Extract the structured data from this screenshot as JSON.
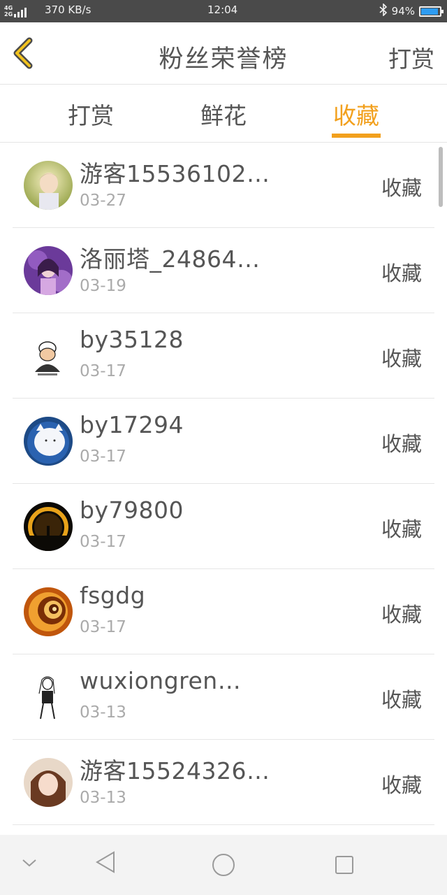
{
  "status_bar": {
    "network": "4G",
    "network2": "2G",
    "speed": "370 KB/s",
    "time": "12:04",
    "battery": "94%",
    "battery_level": 0.94,
    "battery_color": "#2e9cf2"
  },
  "header": {
    "back_icon": "chevron-left-icon",
    "title": "粉丝荣誉榜",
    "action_label": "打赏"
  },
  "tabs": [
    {
      "label": "打赏",
      "active": false
    },
    {
      "label": "鲜花",
      "active": false
    },
    {
      "label": "收藏",
      "active": true
    }
  ],
  "accent_color": "#f2a01d",
  "fans": [
    {
      "name": "游客15536102…",
      "date": "03-27",
      "action": "收藏"
    },
    {
      "name": "洛丽塔_24864…",
      "date": "03-19",
      "action": "收藏"
    },
    {
      "name": "by35128",
      "date": "03-17",
      "action": "收藏"
    },
    {
      "name": "by17294",
      "date": "03-17",
      "action": "收藏"
    },
    {
      "name": "by79800",
      "date": "03-17",
      "action": "收藏"
    },
    {
      "name": "fsgdg",
      "date": "03-17",
      "action": "收藏"
    },
    {
      "name": "wuxiongren…",
      "date": "03-13",
      "action": "收藏"
    },
    {
      "name": "游客15524326…",
      "date": "03-13",
      "action": "收藏"
    }
  ],
  "nav_bar": {
    "icons": [
      "chevron-down-icon",
      "back-triangle-icon",
      "home-circle-icon",
      "recents-square-icon"
    ]
  }
}
